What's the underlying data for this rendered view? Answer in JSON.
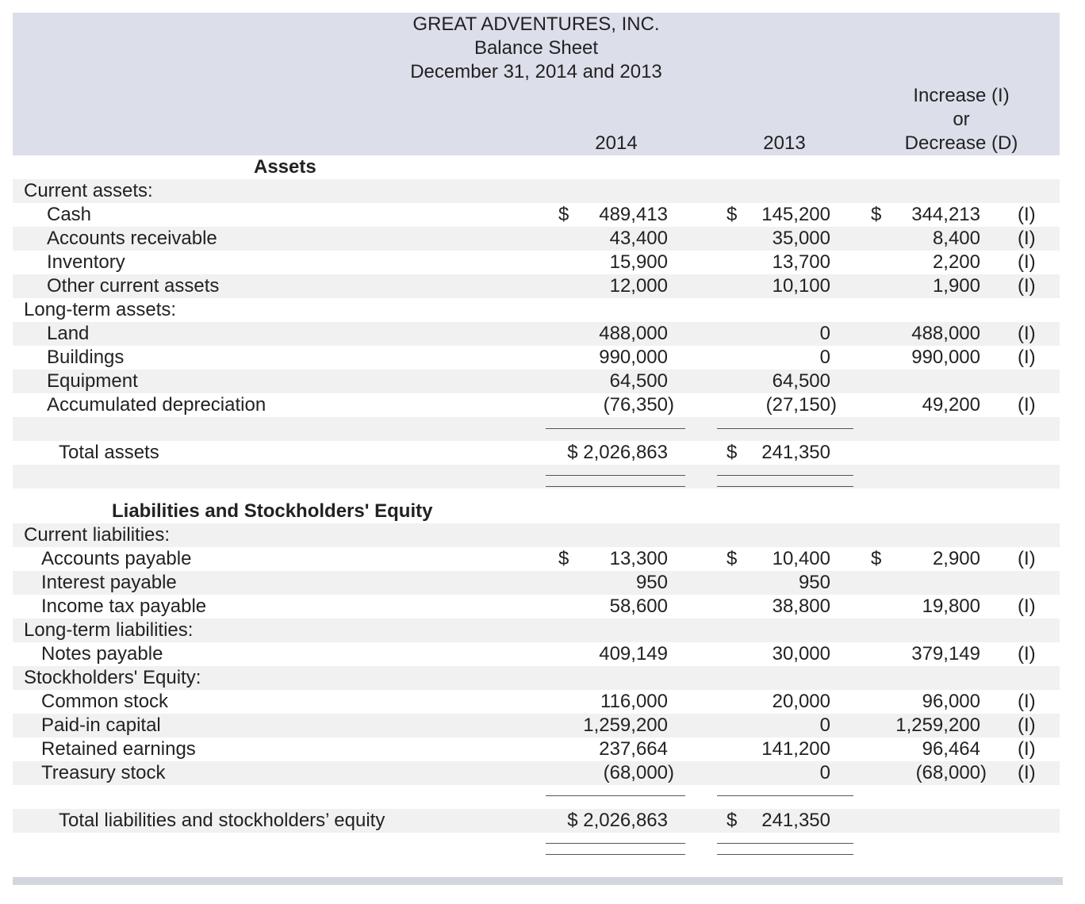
{
  "header": {
    "company": "GREAT ADVENTURES, INC.",
    "statement": "Balance Sheet",
    "date": "December 31, 2014 and 2013",
    "col_2014": "2014",
    "col_2013": "2013",
    "col_change_line1": "Increase (I)",
    "col_change_line2": "or",
    "col_change_line3": "Decrease (D)"
  },
  "assets_heading": "Assets",
  "rows": [
    {
      "label": "Current assets:",
      "v2014": "",
      "v2013": "",
      "change": "",
      "ind": ""
    },
    {
      "label": "Cash",
      "d2014": "$",
      "v2014": "489,413",
      "d2013": "$",
      "v2013": "145,200",
      "dchg": "$",
      "change": "344,213",
      "ind": "(I)"
    },
    {
      "label": "Accounts receivable",
      "v2014": "43,400",
      "v2013": "35,000",
      "change": "8,400",
      "ind": "(I)"
    },
    {
      "label": "Inventory",
      "v2014": "15,900",
      "v2013": "13,700",
      "change": "2,200",
      "ind": "(I)"
    },
    {
      "label": "Other current assets",
      "v2014": "12,000",
      "v2013": "10,100",
      "change": "1,900",
      "ind": "(I)"
    },
    {
      "label": "Long-term assets:",
      "v2014": "",
      "v2013": "",
      "change": "",
      "ind": ""
    },
    {
      "label": "Land",
      "v2014": "488,000",
      "v2013": "0",
      "change": "488,000",
      "ind": "(I)"
    },
    {
      "label": "Buildings",
      "v2014": "990,000",
      "v2013": "0",
      "change": "990,000",
      "ind": "(I)"
    },
    {
      "label": "Equipment",
      "v2014": "64,500",
      "v2013": "64,500",
      "change": "",
      "ind": ""
    },
    {
      "label": "Accumulated depreciation",
      "v2014": "(76,350)",
      "v2013": "(27,150)",
      "change": "49,200",
      "ind": "(I)"
    }
  ],
  "total_assets": {
    "label": "Total assets",
    "v2014": "$ 2,026,863",
    "d2013": "$",
    "v2013": "241,350"
  },
  "liab_heading": "Liabilities and Stockholders' Equity",
  "liab_rows": [
    {
      "label": "Current liabilities:",
      "v2014": "",
      "v2013": "",
      "change": "",
      "ind": ""
    },
    {
      "label": "Accounts payable",
      "d2014": "$",
      "v2014": "13,300",
      "d2013": "$",
      "v2013": "10,400",
      "dchg": "$",
      "change": "2,900",
      "ind": "(I)"
    },
    {
      "label": "Interest payable",
      "v2014": "950",
      "v2013": "950",
      "change": "",
      "ind": ""
    },
    {
      "label": "Income tax payable",
      "v2014": "58,600",
      "v2013": "38,800",
      "change": "19,800",
      "ind": "(I)"
    },
    {
      "label": "Long-term liabilities:",
      "v2014": "",
      "v2013": "",
      "change": "",
      "ind": ""
    },
    {
      "label": "Notes payable",
      "v2014": "409,149",
      "v2013": "30,000",
      "change": "379,149",
      "ind": "(I)"
    },
    {
      "label": "Stockholders' Equity:",
      "v2014": "",
      "v2013": "",
      "change": "",
      "ind": ""
    },
    {
      "label": "Common stock",
      "v2014": "116,000",
      "v2013": "20,000",
      "change": "96,000",
      "ind": "(I)"
    },
    {
      "label": "Paid-in capital",
      "v2014": "1,259,200",
      "v2013": "0",
      "change": "1,259,200",
      "ind": "(I)"
    },
    {
      "label": "Retained earnings",
      "v2014": "237,664",
      "v2013": "141,200",
      "change": "96,464",
      "ind": "(I)"
    },
    {
      "label": "Treasury stock",
      "v2014": "(68,000)",
      "v2013": "0",
      "change": "(68,000)",
      "ind": "(I)"
    }
  ],
  "total_liab": {
    "label": "Total liabilities and stockholders’ equity",
    "v2014": "$ 2,026,863",
    "d2013": "$",
    "v2013": "241,350"
  }
}
